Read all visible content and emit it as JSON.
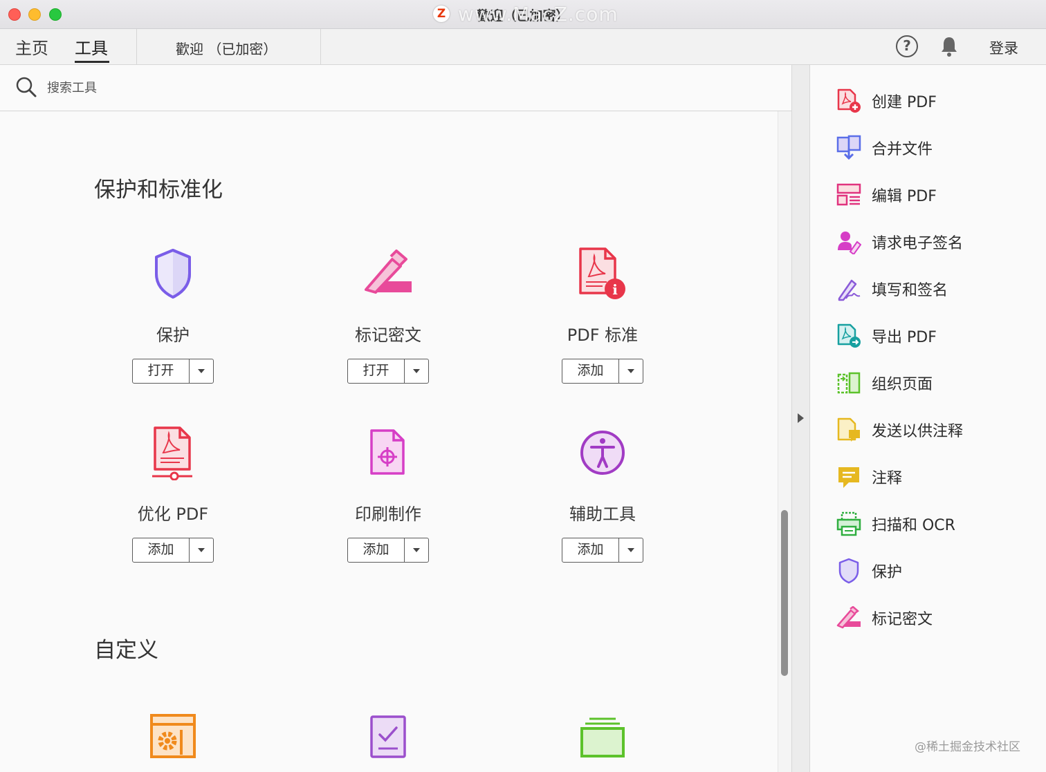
{
  "window": {
    "title": "歡迎（已加密）",
    "watermark_logo": "Z",
    "watermark_text": "www.MacZ.com"
  },
  "tabs": {
    "home": "主页",
    "tools": "工具",
    "document": "歡迎 （已加密）"
  },
  "header": {
    "help_glyph": "?",
    "login": "登录"
  },
  "search": {
    "placeholder": "搜索工具"
  },
  "sections": {
    "protect_standardize": "保护和标准化",
    "customize": "自定义"
  },
  "tools": [
    {
      "label": "保护",
      "button": "打开",
      "icon": "shield-icon"
    },
    {
      "label": "标记密文",
      "button": "打开",
      "icon": "redact-marker-icon"
    },
    {
      "label": "PDF 标准",
      "button": "添加",
      "icon": "pdf-standard-icon"
    },
    {
      "label": "优化 PDF",
      "button": "添加",
      "icon": "optimize-pdf-icon"
    },
    {
      "label": "印刷制作",
      "button": "添加",
      "icon": "print-production-icon"
    },
    {
      "label": "辅助工具",
      "button": "添加",
      "icon": "accessibility-icon"
    }
  ],
  "custom_tools_icons": [
    "action-wizard-icon",
    "checklist-icon",
    "folder-stack-icon"
  ],
  "right_panel": {
    "items": [
      {
        "label": "创建 PDF",
        "icon": "create-pdf-icon"
      },
      {
        "label": "合并文件",
        "icon": "combine-files-icon"
      },
      {
        "label": "编辑 PDF",
        "icon": "edit-pdf-icon"
      },
      {
        "label": "请求电子签名",
        "icon": "request-signature-icon"
      },
      {
        "label": "填写和签名",
        "icon": "fill-sign-icon"
      },
      {
        "label": "导出 PDF",
        "icon": "export-pdf-icon"
      },
      {
        "label": "组织页面",
        "icon": "organize-pages-icon"
      },
      {
        "label": "发送以供注释",
        "icon": "send-comments-icon"
      },
      {
        "label": "注释",
        "icon": "comment-icon"
      },
      {
        "label": "扫描和 OCR",
        "icon": "scan-ocr-icon"
      },
      {
        "label": "保护",
        "icon": "shield-icon"
      },
      {
        "label": "标记密文",
        "icon": "redact-marker-icon"
      }
    ],
    "credit": "@稀土掘金技术社区"
  },
  "colors": {
    "accent_red": "#e8364a",
    "accent_purple": "#7a5de8",
    "accent_magenta": "#d63ec6",
    "accent_teal": "#17a0a0",
    "accent_green": "#2fae3f",
    "accent_yellow": "#e6b820",
    "accent_orange": "#f08a1c"
  }
}
